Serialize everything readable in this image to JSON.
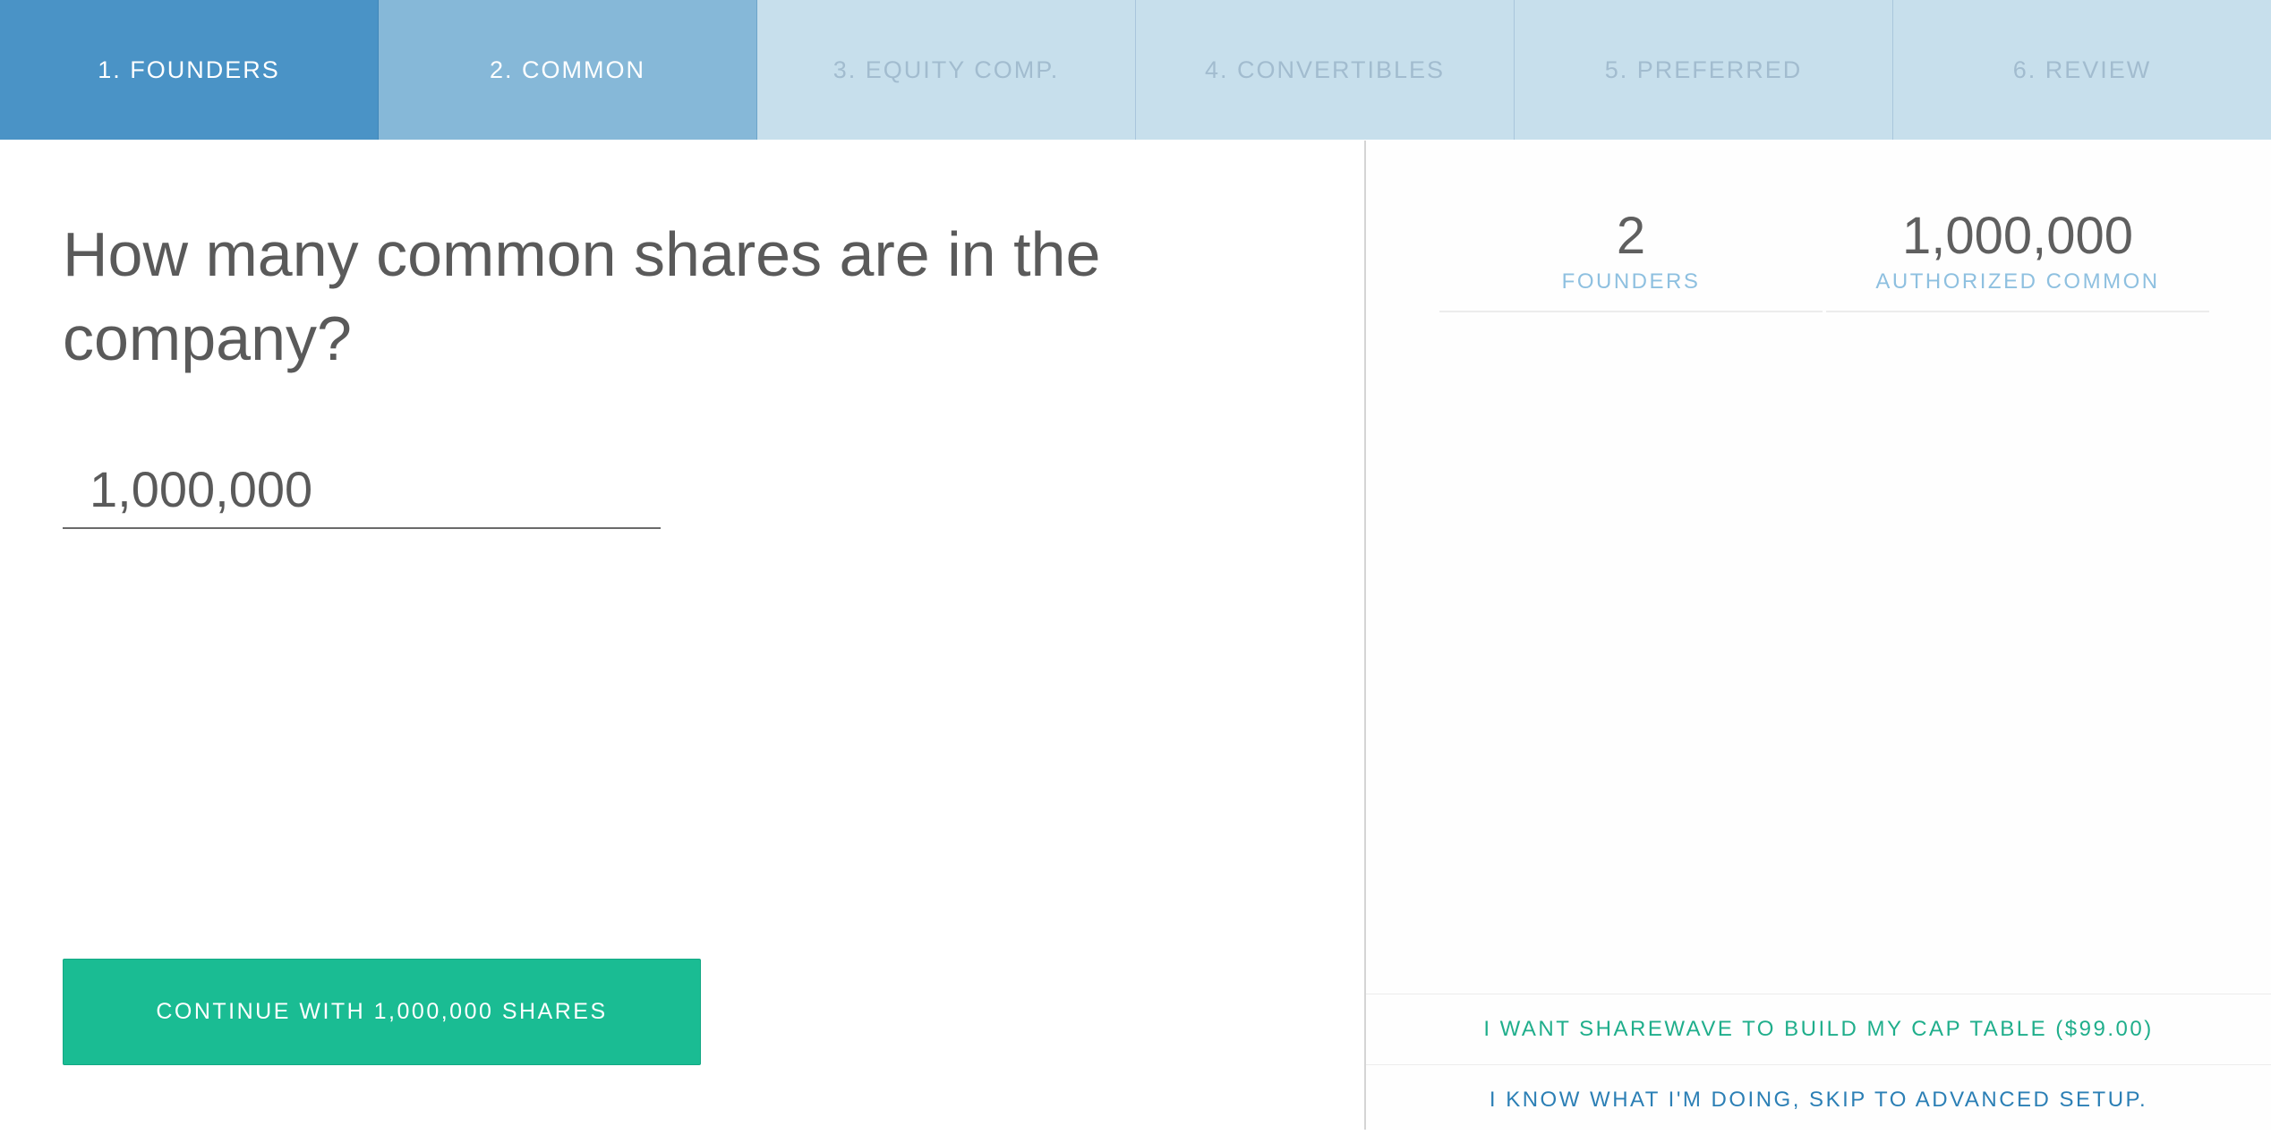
{
  "steps": [
    {
      "label": "1. FOUNDERS",
      "state": "complete"
    },
    {
      "label": "2. COMMON",
      "state": "active"
    },
    {
      "label": "3. EQUITY COMP.",
      "state": "upcoming"
    },
    {
      "label": "4. CONVERTIBLES",
      "state": "upcoming"
    },
    {
      "label": "5. PREFERRED",
      "state": "upcoming"
    },
    {
      "label": "6. REVIEW",
      "state": "upcoming"
    }
  ],
  "main": {
    "question": "How many common shares are in the company?",
    "shares_input_value": "1,000,000",
    "continue_label": "CONTINUE WITH 1,000,000 SHARES"
  },
  "summary": {
    "founders": {
      "value": "2",
      "label": "FOUNDERS"
    },
    "authorized_common": {
      "value": "1,000,000",
      "label": "AUTHORIZED COMMON"
    }
  },
  "links": {
    "build_cap_table": "I WANT SHAREWAVE TO BUILD MY CAP TABLE ($99.00)",
    "skip_setup": "I KNOW WHAT I'M DOING, SKIP TO ADVANCED SETUP."
  },
  "colors": {
    "step_complete": "#4a93c6",
    "step_active": "#86b8d8",
    "step_upcoming": "#c7dfec",
    "primary_button": "#1abc93",
    "link_green": "#1fae8b",
    "link_blue": "#2b7fb5",
    "stat_label": "#8ec0e0"
  }
}
